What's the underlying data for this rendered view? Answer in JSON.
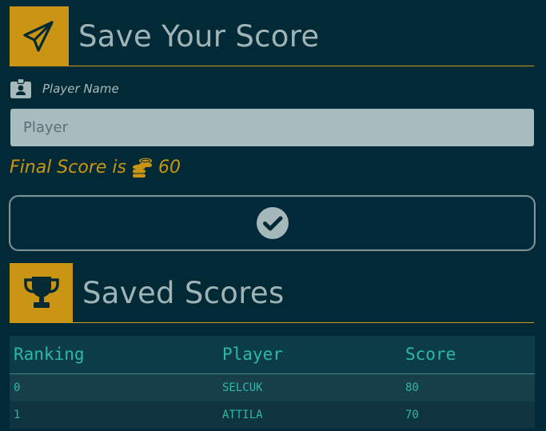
{
  "save_section": {
    "title": "Save Your Score",
    "icon": "paper-plane-icon",
    "name_label": "Player Name",
    "name_label_icon": "id-badge-icon",
    "name_input": {
      "value": "",
      "placeholder": "Player"
    },
    "final_score": {
      "prefix": "Final Score is",
      "icon": "coins-icon",
      "value": "60"
    },
    "submit_icon": "check-circle-icon"
  },
  "saved_section": {
    "title": "Saved Scores",
    "icon": "trophy-icon",
    "table": {
      "headers": [
        "Ranking",
        "Player",
        "Score"
      ],
      "rows": [
        [
          "0",
          "SELCUK",
          "80"
        ],
        [
          "1",
          "ATTILA",
          "70"
        ]
      ]
    }
  },
  "colors": {
    "background": "#012a36",
    "accent": "#c99512",
    "table_text": "#2cb8a6",
    "header_text": "#9fb4b6",
    "input_background": "#a6bcbe"
  }
}
